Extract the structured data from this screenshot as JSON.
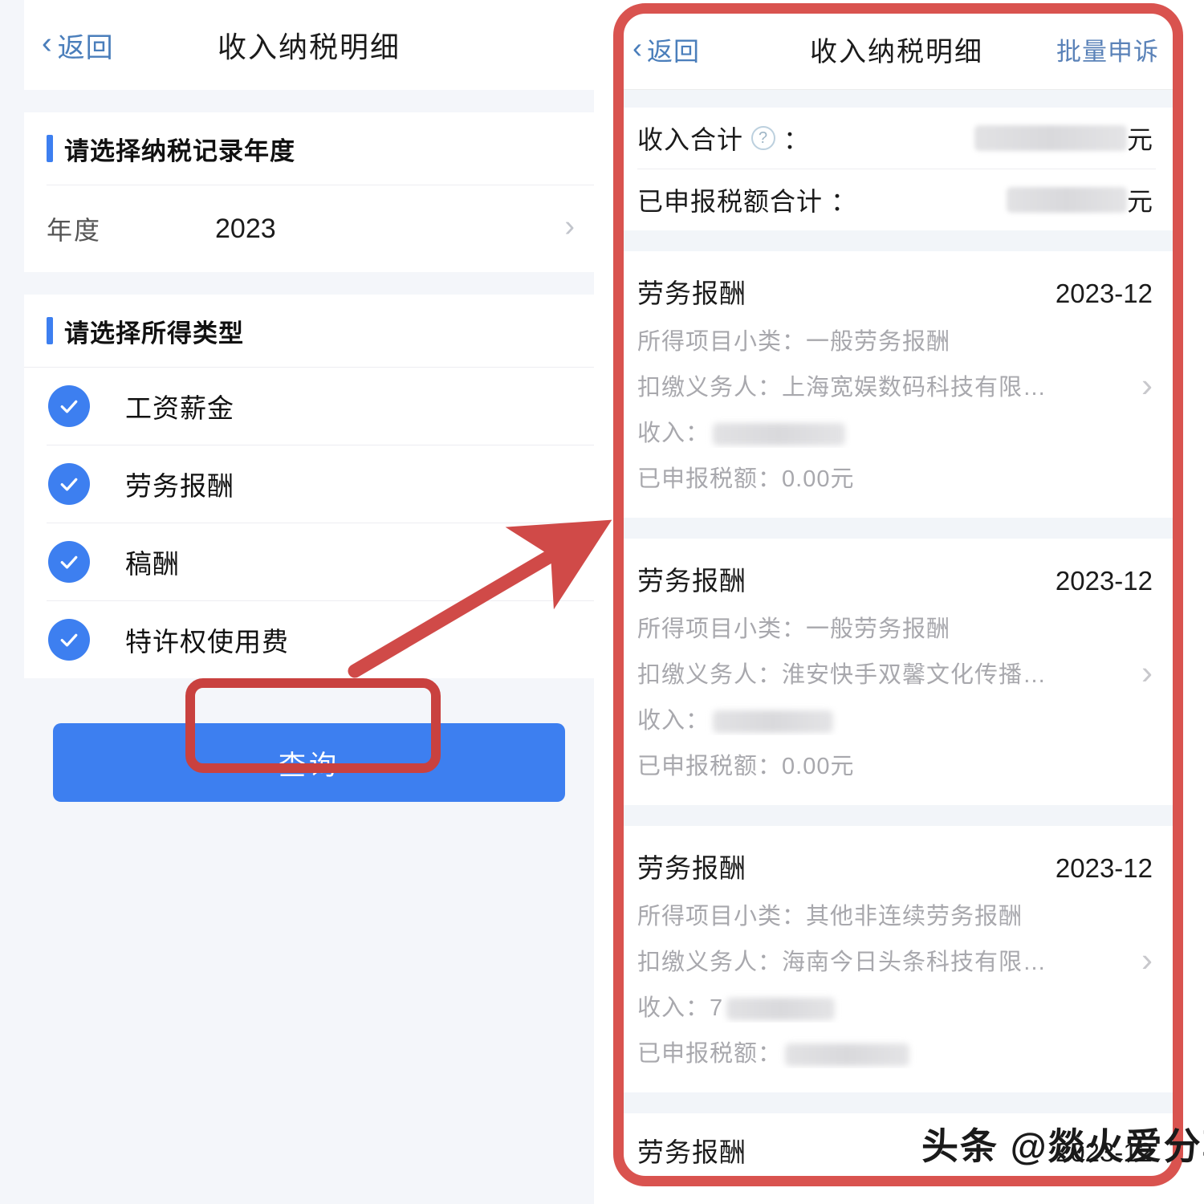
{
  "left_screen": {
    "nav": {
      "back_label": "返回",
      "title": "收入纳税明细"
    },
    "year_section": {
      "heading": "请选择纳税记录年度",
      "row_label": "年度",
      "row_value": "2023"
    },
    "type_section": {
      "heading": "请选择所得类型",
      "options": [
        {
          "label": "工资薪金",
          "checked": true
        },
        {
          "label": "劳务报酬",
          "checked": true
        },
        {
          "label": "稿酬",
          "checked": true
        },
        {
          "label": "特许权使用费",
          "checked": true
        }
      ]
    },
    "query_button": "查询"
  },
  "right_screen": {
    "nav": {
      "back_label": "返回",
      "title": "收入纳税明细",
      "action_label": "批量申诉"
    },
    "summary": [
      {
        "label": "收入合计",
        "has_help_icon": true,
        "colon": "：",
        "value": "",
        "value_redacted": true,
        "unit": "元"
      },
      {
        "label": "已申报税额合计",
        "has_help_icon": false,
        "colon": "：",
        "value": "",
        "value_redacted": true,
        "unit": "元"
      }
    ],
    "field_labels": {
      "subcategory": "所得项目小类：",
      "withholding_agent": "扣缴义务人：",
      "income": "收入：",
      "declared_tax": "已申报税额："
    },
    "records": [
      {
        "type": "劳务报酬",
        "date": "2023-12",
        "subcategory": "一般劳务报酬",
        "withholding_agent": "上海宽娱数码科技有限…",
        "income": "",
        "income_redacted": true,
        "declared_tax": "0.00元",
        "declared_tax_redacted": false
      },
      {
        "type": "劳务报酬",
        "date": "2023-12",
        "subcategory": "一般劳务报酬",
        "withholding_agent": "淮安快手双馨文化传播…",
        "income": "",
        "income_redacted": true,
        "declared_tax": "0.00元",
        "declared_tax_redacted": false
      },
      {
        "type": "劳务报酬",
        "date": "2023-12",
        "subcategory": "其他非连续劳务报酬",
        "withholding_agent": "海南今日头条科技有限…",
        "income": "7",
        "income_redacted": true,
        "declared_tax": "",
        "declared_tax_redacted": true
      },
      {
        "type": "劳务报酬",
        "date": "2023-12",
        "subcategory": "",
        "withholding_agent": "",
        "income": "",
        "declared_tax": ""
      }
    ]
  },
  "annotations": {
    "watermark": "头条 @燚火爱分享",
    "highlight_color": "#d9534f",
    "arrow_color": "#d04a48"
  },
  "colors": {
    "accent_blue": "#3d7ff0",
    "link_blue": "#4a7ebb",
    "page_bg": "#f4f6fa",
    "card_bg": "#ffffff",
    "muted_text": "#a8a8ad"
  }
}
